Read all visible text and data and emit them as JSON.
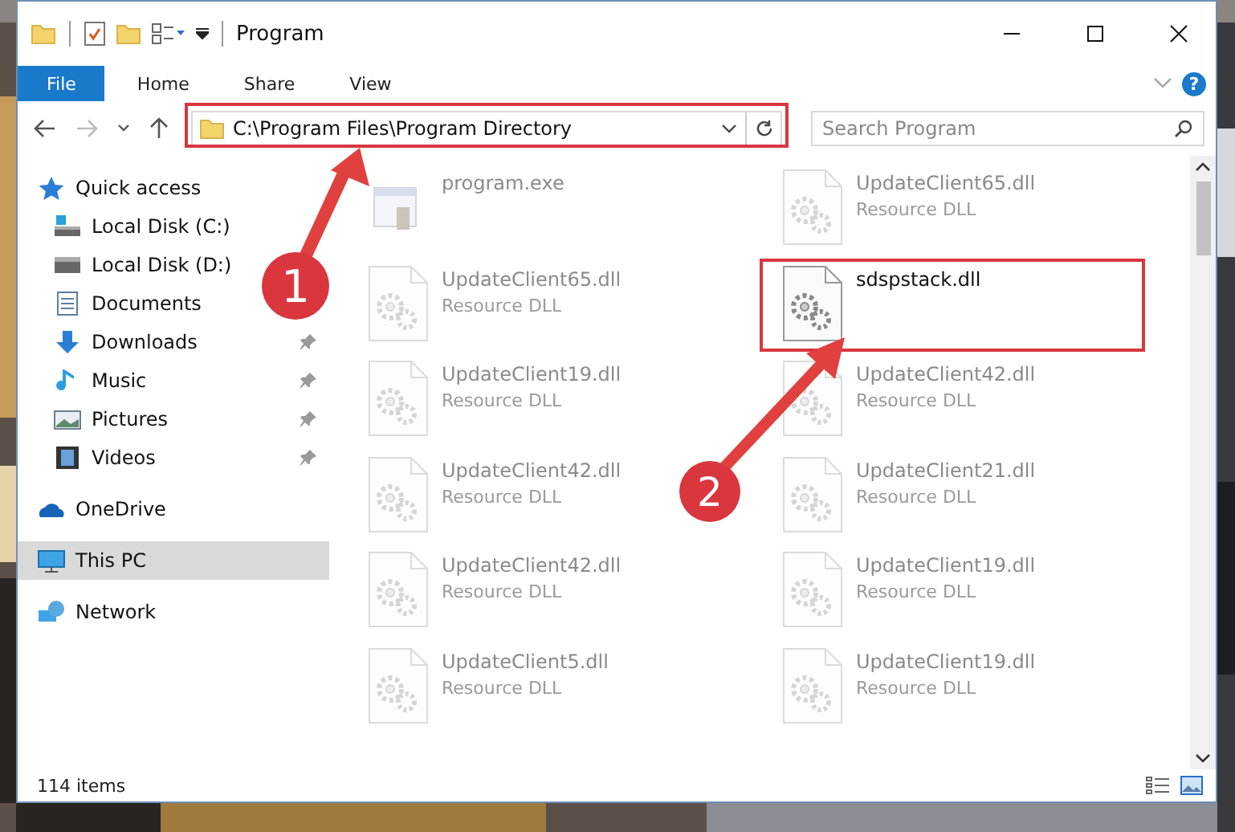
{
  "window": {
    "title": "Program"
  },
  "ribbon": {
    "tabs": [
      {
        "label": "File",
        "kind": "file"
      },
      {
        "label": "Home",
        "kind": "tab"
      },
      {
        "label": "Share",
        "kind": "tab"
      },
      {
        "label": "View",
        "kind": "tab"
      }
    ],
    "help": "?"
  },
  "address": {
    "path": "C:\\Program Files\\Program Directory"
  },
  "search": {
    "placeholder": "Search Program"
  },
  "sidebar": {
    "items": [
      {
        "label": "Quick access",
        "kind": "star",
        "selected": false,
        "children": [
          {
            "label": "Local Disk (C:)",
            "kind": "disk-c"
          },
          {
            "label": "Local Disk (D:)",
            "kind": "disk"
          },
          {
            "label": "Documents",
            "kind": "docs"
          },
          {
            "label": "Downloads",
            "kind": "download",
            "pinned": true
          },
          {
            "label": "Music",
            "kind": "music",
            "pinned": true
          },
          {
            "label": "Pictures",
            "kind": "pictures",
            "pinned": true
          },
          {
            "label": "Videos",
            "kind": "videos",
            "pinned": true
          }
        ]
      },
      {
        "label": "OneDrive",
        "kind": "cloud",
        "selected": false
      },
      {
        "label": "This PC",
        "kind": "pc",
        "selected": true
      },
      {
        "label": "Network",
        "kind": "network",
        "selected": false
      }
    ]
  },
  "files": [
    {
      "name": "program.exe",
      "kind": "exe",
      "faded": true
    },
    {
      "name": "UpdateClient65.dll",
      "type": "Resource DLL",
      "kind": "dll",
      "faded": true
    },
    {
      "name": "UpdateClient65.dll",
      "type": "Resource DLL",
      "kind": "dll",
      "faded": true
    },
    {
      "name": "sdspstack.dll",
      "kind": "dll",
      "faded": false
    },
    {
      "name": "UpdateClient19.dll",
      "type": "Resource DLL",
      "kind": "dll",
      "faded": true
    },
    {
      "name": "UpdateClient42.dll",
      "type": "Resource DLL",
      "kind": "dll",
      "faded": true
    },
    {
      "name": "UpdateClient42.dll",
      "type": "Resource DLL",
      "kind": "dll",
      "faded": true
    },
    {
      "name": "UpdateClient21.dll",
      "type": "Resource DLL",
      "kind": "dll",
      "faded": true
    },
    {
      "name": "UpdateClient42.dll",
      "type": "Resource DLL",
      "kind": "dll",
      "faded": true
    },
    {
      "name": "UpdateClient19.dll",
      "type": "Resource DLL",
      "kind": "dll",
      "faded": true
    },
    {
      "name": "UpdateClient5.dll",
      "type": "Resource DLL",
      "kind": "dll",
      "faded": true
    },
    {
      "name": "UpdateClient19.dll",
      "type": "Resource DLL",
      "kind": "dll",
      "faded": true
    }
  ],
  "status_bar": {
    "count": "114 items"
  },
  "annotations": [
    {
      "label": "1"
    },
    {
      "label": "2"
    }
  ]
}
